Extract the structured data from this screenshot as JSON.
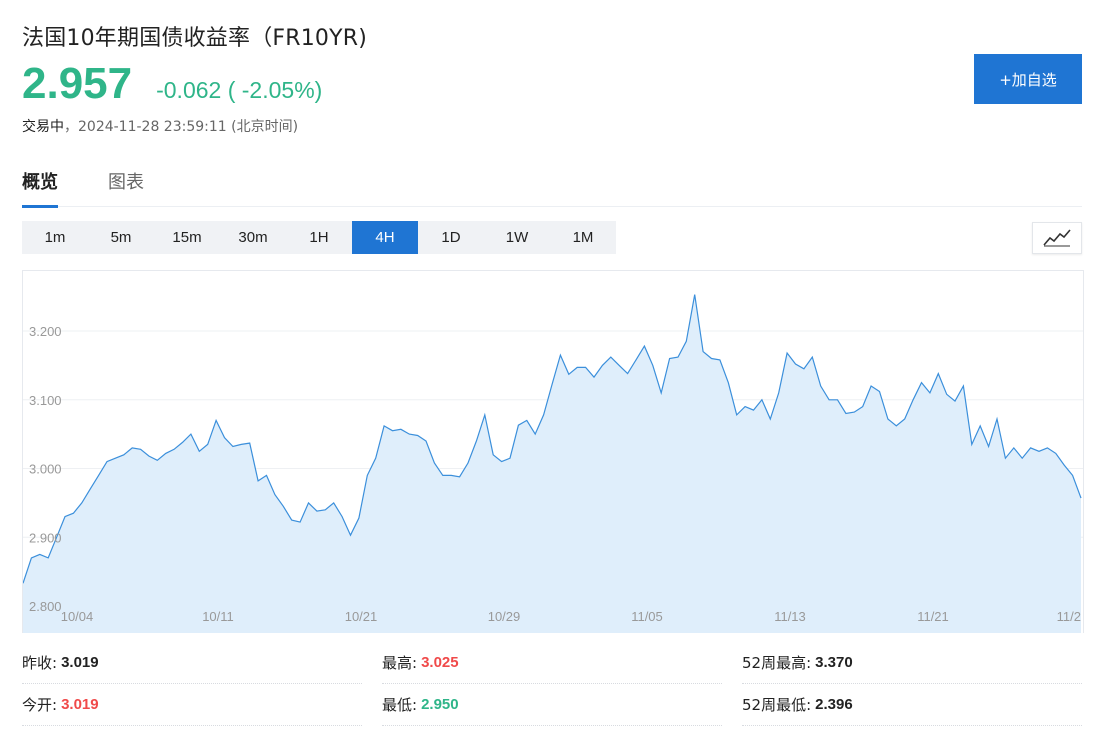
{
  "header": {
    "title": "法国10年期国债收益率（FR10YR)",
    "price": "2.957",
    "change": "-0.062 ( -2.05%)",
    "status": "交易中",
    "timestamp": "2024-11-28 23:59:11 (北京时间)",
    "add_button": "+加自选"
  },
  "tabs": [
    {
      "label": "概览",
      "active": true
    },
    {
      "label": "图表",
      "active": false
    }
  ],
  "periods": [
    "1m",
    "5m",
    "15m",
    "30m",
    "1H",
    "4H",
    "1D",
    "1W",
    "1M"
  ],
  "active_period": "4H",
  "colors": {
    "accent": "#1f75d3",
    "down": "#2fb589",
    "up": "#f04a4a",
    "line": "#3b8fdb",
    "fill": "#dfeefb"
  },
  "icons": {
    "chart_type": "line-chart-icon"
  },
  "chart_data": {
    "type": "area",
    "ylim": [
      2.8,
      3.2
    ],
    "y_ticks": [
      "3.200",
      "3.100",
      "3.000",
      "2.900",
      "2.800"
    ],
    "x_tick_labels": [
      "10/04",
      "10/11",
      "10/21",
      "10/29",
      "11/05",
      "11/13",
      "11/21",
      "11/2"
    ],
    "values": [
      2.833,
      2.87,
      2.875,
      2.87,
      2.9,
      2.93,
      2.935,
      2.95,
      2.97,
      2.99,
      3.01,
      3.015,
      3.02,
      3.03,
      3.028,
      3.018,
      3.012,
      3.022,
      3.028,
      3.038,
      3.05,
      3.025,
      3.035,
      3.07,
      3.045,
      3.032,
      3.035,
      3.037,
      2.982,
      2.99,
      2.962,
      2.945,
      2.925,
      2.922,
      2.95,
      2.938,
      2.94,
      2.95,
      2.93,
      2.903,
      2.928,
      2.99,
      3.015,
      3.062,
      3.055,
      3.057,
      3.05,
      3.048,
      3.04,
      3.008,
      2.99,
      2.99,
      2.988,
      3.008,
      3.04,
      3.078,
      3.02,
      3.01,
      3.015,
      3.063,
      3.07,
      3.05,
      3.078,
      3.122,
      3.165,
      3.137,
      3.147,
      3.147,
      3.133,
      3.15,
      3.162,
      3.15,
      3.138,
      3.158,
      3.178,
      3.15,
      3.11,
      3.16,
      3.162,
      3.185,
      3.253,
      3.17,
      3.16,
      3.158,
      3.125,
      3.078,
      3.09,
      3.085,
      3.1,
      3.072,
      3.11,
      3.168,
      3.152,
      3.145,
      3.162,
      3.12,
      3.1,
      3.1,
      3.08,
      3.082,
      3.09,
      3.12,
      3.112,
      3.072,
      3.062,
      3.072,
      3.1,
      3.125,
      3.11,
      3.138,
      3.108,
      3.098,
      3.12,
      3.035,
      3.062,
      3.032,
      3.072,
      3.015,
      3.03,
      3.015,
      3.03,
      3.025,
      3.03,
      3.022,
      3.005,
      2.99,
      2.957
    ]
  },
  "stats": [
    {
      "label": "昨收:",
      "value": "3.019",
      "tone": "neu"
    },
    {
      "label": "最高:",
      "value": "3.025",
      "tone": "up"
    },
    {
      "label": "52周最高:",
      "value": "3.370",
      "tone": "neu"
    },
    {
      "label": "今开:",
      "value": "3.019",
      "tone": "up"
    },
    {
      "label": "最低:",
      "value": "2.950",
      "tone": "down"
    },
    {
      "label": "52周最低:",
      "value": "2.396",
      "tone": "neu"
    }
  ]
}
